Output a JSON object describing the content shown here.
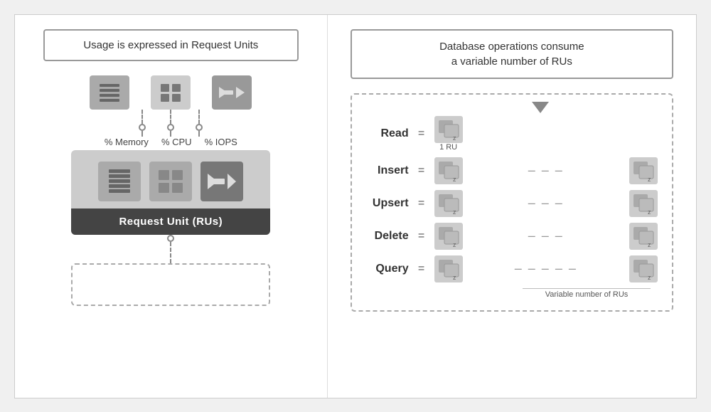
{
  "left": {
    "header": "Usage is expressed in Request Units",
    "icons": [
      {
        "id": "memory",
        "label": "% Memory"
      },
      {
        "id": "cpu",
        "label": "% CPU"
      },
      {
        "id": "iops",
        "label": "% IOPS"
      }
    ],
    "ru_label": "Request Unit (RUs)"
  },
  "right": {
    "header_line1": "Database operations consume",
    "header_line2": "a variable number of RUs",
    "operations": [
      {
        "label": "Read",
        "has_dots": false,
        "single": true
      },
      {
        "label": "Insert",
        "has_dots": true,
        "single": false
      },
      {
        "label": "Upsert",
        "has_dots": true,
        "single": false
      },
      {
        "label": "Delete",
        "has_dots": true,
        "single": false
      },
      {
        "label": "Query",
        "has_dots": true,
        "single": false,
        "long_dots": true
      }
    ],
    "read_ru_label": "1 RU",
    "variable_note": "Variable number of RUs"
  }
}
